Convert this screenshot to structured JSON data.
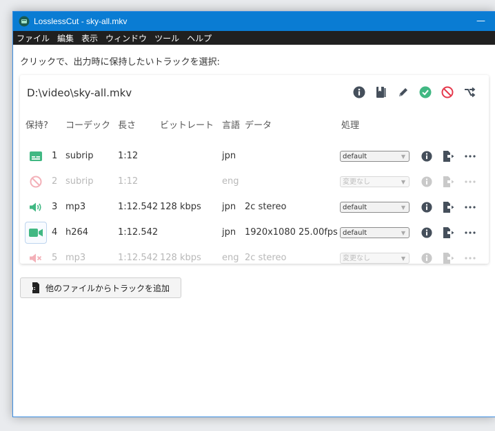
{
  "window": {
    "title": "LosslessCut - sky-all.mkv",
    "minimize": "—"
  },
  "menu": [
    "ファイル",
    "編集",
    "表示",
    "ウィンドウ",
    "ツール",
    "ヘルプ"
  ],
  "instruction": "クリックで、出力時に保持したいトラックを選択:",
  "file": {
    "path": "D:\\video\\sky-all.mkv"
  },
  "columns": {
    "keep": "保持?",
    "codec": "コーデック",
    "duration": "長さ",
    "bitrate": "ビットレート",
    "language": "言語",
    "data": "データ",
    "action": "処理"
  },
  "tracks": [
    {
      "index": "1",
      "codec": "subrip",
      "duration": "1:12",
      "bitrate": "",
      "language": "jpn",
      "data": "",
      "disposition": "default",
      "enabled": true,
      "kind": "subtitle"
    },
    {
      "index": "2",
      "codec": "subrip",
      "duration": "1:12",
      "bitrate": "",
      "language": "eng",
      "data": "",
      "disposition": "変更なし",
      "enabled": false,
      "kind": "subtitle"
    },
    {
      "index": "3",
      "codec": "mp3",
      "duration": "1:12.542",
      "bitrate": "128 kbps",
      "language": "jpn",
      "data": "2c stereo",
      "disposition": "default",
      "enabled": true,
      "kind": "audio"
    },
    {
      "index": "4",
      "codec": "h264",
      "duration": "1:12.542",
      "bitrate": "",
      "language": "jpn",
      "data": "1920x1080 25.00fps",
      "disposition": "default",
      "enabled": true,
      "kind": "video"
    },
    {
      "index": "5",
      "codec": "mp3",
      "duration": "1:12.542",
      "bitrate": "128 kbps",
      "language": "eng",
      "data": "2c stereo",
      "disposition": "変更なし",
      "enabled": false,
      "kind": "audio"
    }
  ],
  "add_button": {
    "label": "他のファイルからトラックを追加"
  },
  "colors": {
    "titlebar": "#0a7cd3",
    "menubar": "#202020",
    "keep_green": "#41b883",
    "danger_red": "#e5394c",
    "icon_dark": "#454f5b"
  },
  "icons": {
    "info": "info-circle-icon",
    "tags": "bookmark-icon",
    "edit": "pencil-icon",
    "keep_all": "check-circle-icon",
    "discard_all": "ban-icon",
    "shuffle": "shuffle-icon",
    "export": "file-export-icon",
    "more": "more-dots-icon"
  }
}
